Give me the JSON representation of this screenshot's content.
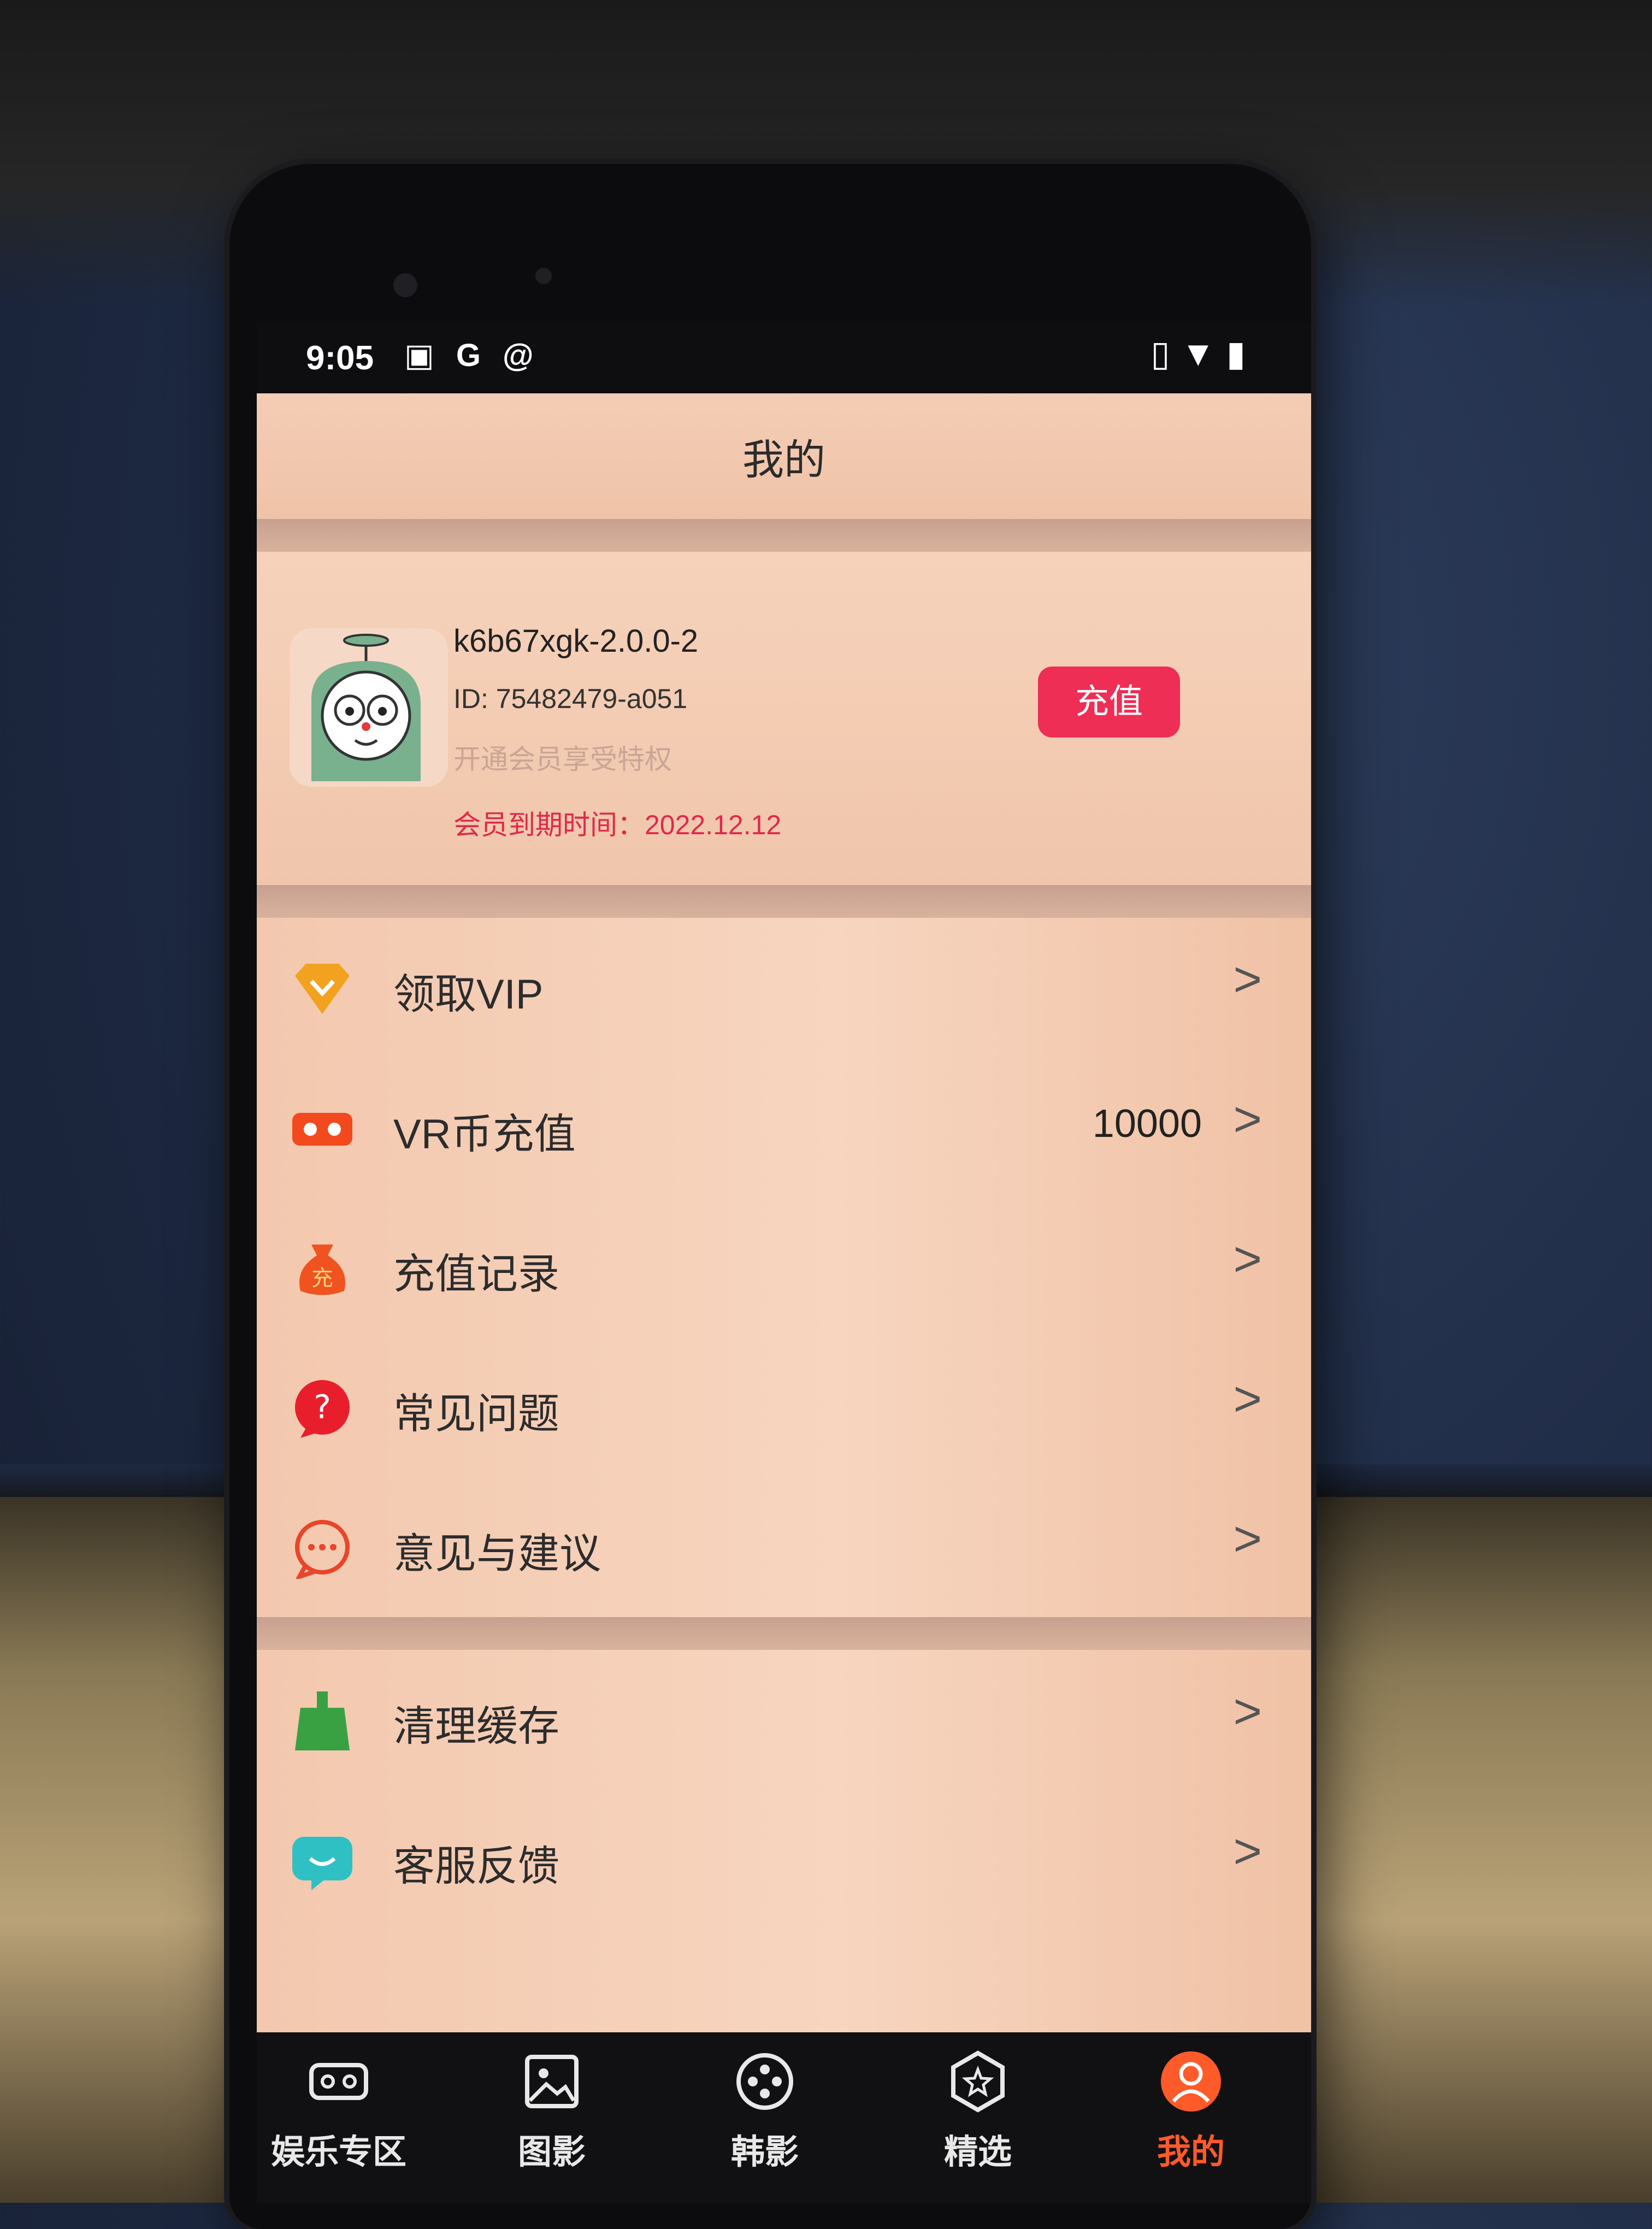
{
  "status": {
    "time": "9:05",
    "left_icons": [
      "image-icon",
      "google-icon",
      "at-icon"
    ],
    "right_icons": [
      "vibrate-icon",
      "wifi-icon",
      "battery-icon"
    ]
  },
  "header": {
    "title": "我的"
  },
  "profile": {
    "username": "k6b67xgk-2.0.0-2",
    "id": "ID: 75482479-a051",
    "hint": "开通会员享受特权",
    "expiry": "会员到期时间：2022.12.12",
    "recharge_label": "充值"
  },
  "menu_group1": [
    {
      "icon": "diamond-icon",
      "label": "领取VIP",
      "value": ""
    },
    {
      "icon": "vr-glasses-icon",
      "label": "VR币充值",
      "value": "10000"
    },
    {
      "icon": "money-bag-icon",
      "label": "充值记录",
      "value": ""
    },
    {
      "icon": "question-icon",
      "label": "常见问题",
      "value": ""
    },
    {
      "icon": "chat-bubble-icon",
      "label": "意见与建议",
      "value": ""
    }
  ],
  "menu_group2": [
    {
      "icon": "broom-icon",
      "label": "清理缓存",
      "value": ""
    },
    {
      "icon": "customer-service-icon",
      "label": "客服反馈",
      "value": ""
    }
  ],
  "tabs": [
    {
      "label": "娱乐专区",
      "icon": "vr-headset-icon",
      "active": false
    },
    {
      "label": "图影",
      "icon": "picture-icon",
      "active": false
    },
    {
      "label": "韩影",
      "icon": "film-reel-icon",
      "active": false
    },
    {
      "label": "精选",
      "icon": "star-hexagon-icon",
      "active": false
    },
    {
      "label": "我的",
      "icon": "user-icon",
      "active": true
    }
  ],
  "colors": {
    "accent": "#ee2e55",
    "active_tab": "#ff5a2a"
  }
}
